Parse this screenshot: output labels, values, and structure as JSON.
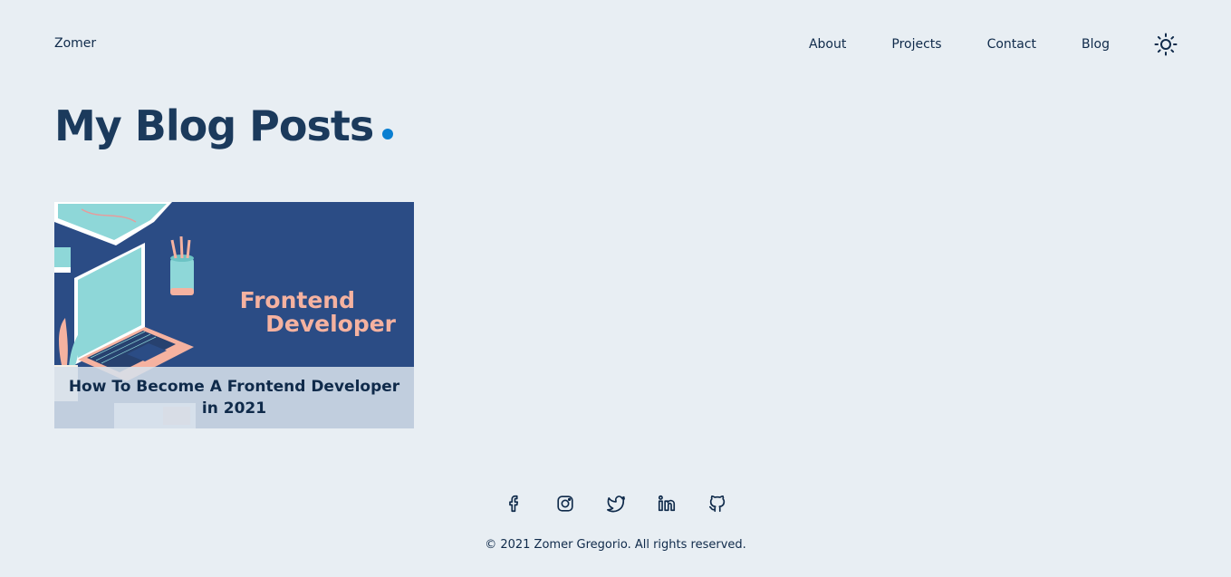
{
  "header": {
    "brand": "Zomer",
    "nav": [
      "About",
      "Projects",
      "Contact",
      "Blog"
    ],
    "theme_icon": "sun-icon"
  },
  "main": {
    "title": "My Blog Posts",
    "posts": [
      {
        "title": "How To Become A Frontend Developer in 2021",
        "image_text_line1": "Frontend",
        "image_text_line2": "Developer"
      }
    ]
  },
  "footer": {
    "social_icons": [
      "facebook-icon",
      "instagram-icon",
      "twitter-icon",
      "linkedin-icon",
      "github-icon"
    ],
    "copyright": "© 2021 Zomer Gregorio. All rights reserved."
  },
  "colors": {
    "background": "#e8eef3",
    "text": "#0f2a4a",
    "accent_dot": "#0a7fd1",
    "card_bg": "#2b4c85",
    "card_text": "#f5b2a0"
  }
}
